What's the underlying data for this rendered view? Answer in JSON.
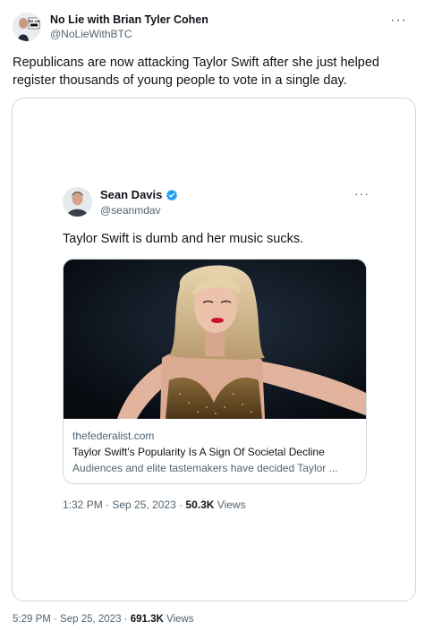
{
  "outer_tweet": {
    "author_name": "No Lie with Brian Tyler Cohen",
    "handle": "@NoLieWithBTC",
    "avatar_badge_text": "NO LIE",
    "text": "Republicans are now attacking Taylor Swift after she just helped register thousands of young people to vote in a single day.",
    "time": "5:29 PM · Sep 25, 2023 · ",
    "views_count": "691.3K",
    "views_label": " Views",
    "more_icon": "more-horizontal-icon"
  },
  "quoted_tweet": {
    "author_name": "Sean Davis",
    "handle": "@seanmdav",
    "verified_icon": "verified-badge-icon",
    "text": "Taylor Swift is dumb and her music sucks.",
    "time": "1:32 PM · Sep 25, 2023 · ",
    "views_count": "50.3K",
    "views_label": " Views",
    "more_icon": "more-horizontal-icon",
    "link_card": {
      "domain": "thefederalist.com",
      "title": "Taylor Swift's Popularity Is A Sign Of Societal Decline",
      "description": "Audiences and elite tastemakers have decided Taylor ..."
    }
  },
  "colors": {
    "text_primary": "#0f1419",
    "text_secondary": "#536471",
    "border": "#cfd9de",
    "verified_blue": "#1d9bf0"
  }
}
